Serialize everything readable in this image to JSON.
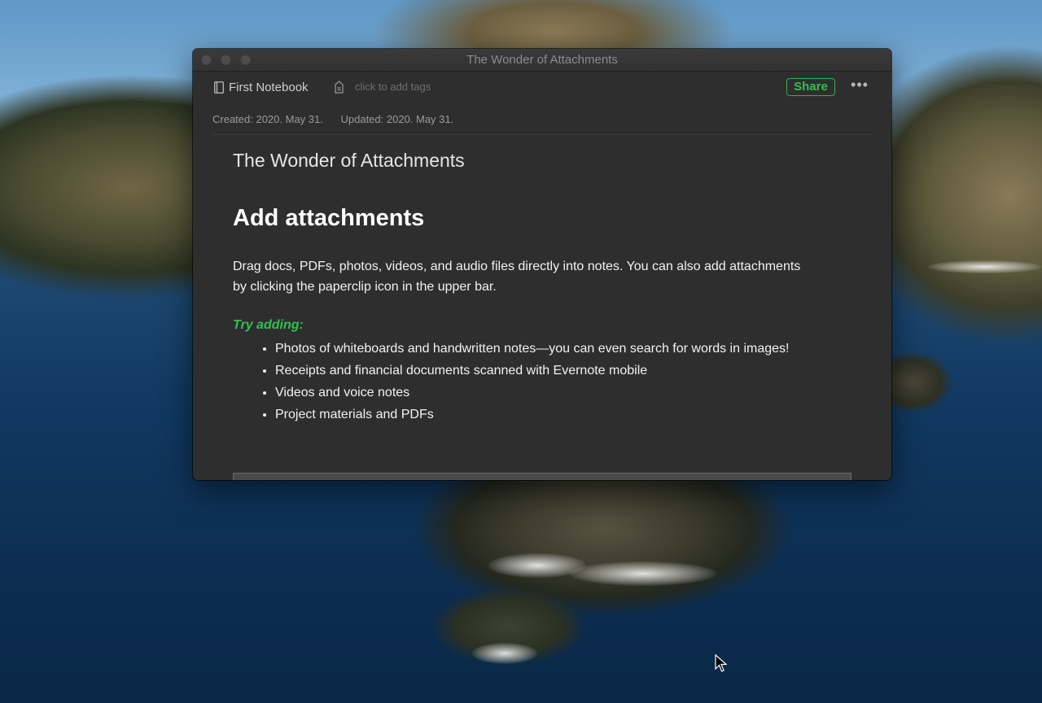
{
  "window": {
    "title": "The Wonder of Attachments"
  },
  "toolbar": {
    "notebook_name": "First Notebook",
    "tags_placeholder": "click to add tags",
    "share_label": "Share",
    "more_label": "•••"
  },
  "meta": {
    "created": "Created: 2020. May 31.",
    "updated": "Updated: 2020. May 31."
  },
  "note": {
    "title": "The Wonder of Attachments",
    "heading": "Add attachments",
    "paragraph": "Drag docs, PDFs, photos, videos, and audio files directly into notes. You can also add attachments by clicking the paperclip icon in the upper bar.",
    "try_label": "Try adding:",
    "bullets": [
      "Photos of whiteboards and handwritten notes—you can even search for words in images!",
      "Receipts and financial documents scanned with Evernote mobile",
      "Videos and voice notes",
      "Project materials and PDFs"
    ]
  },
  "colors": {
    "accent_green": "#2fc24f",
    "window_bg": "#2e2e2e"
  },
  "icons": [
    "notebook-icon",
    "tag-icon",
    "more-icon",
    "cursor-icon"
  ]
}
